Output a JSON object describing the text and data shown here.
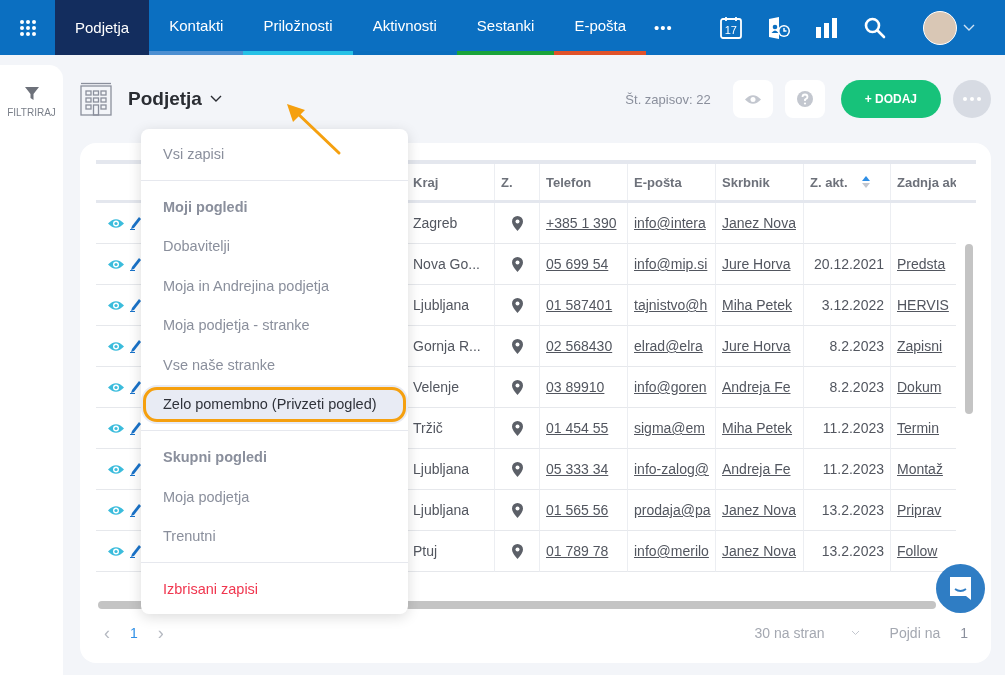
{
  "nav": {
    "tabs": [
      {
        "label": "Podjetja",
        "selected": true,
        "color": "#132d5e"
      },
      {
        "label": "Kontakti",
        "selected": false,
        "color": "#4d8fd1"
      },
      {
        "label": "Priložnosti",
        "selected": false,
        "color": "#26c1e6"
      },
      {
        "label": "Aktivnosti",
        "selected": false,
        "color": "#0a6ebd"
      },
      {
        "label": "Sestanki",
        "selected": false,
        "color": "#19a33a"
      },
      {
        "label": "E-pošta",
        "selected": false,
        "color": "#e0522a"
      }
    ],
    "more": "•••",
    "calendar_day": "17"
  },
  "sidebar": {
    "filter_label": "FILTRIRAJ"
  },
  "header": {
    "title": "Podjetja",
    "record_count": "Št. zapisov: 22",
    "add_button": "+ DODAJ"
  },
  "view_menu": {
    "items": [
      {
        "kind": "option",
        "label": "Vsi zapisi",
        "selected": false,
        "annotated": false
      },
      {
        "kind": "divider"
      },
      {
        "kind": "heading",
        "label": "Moji pogledi"
      },
      {
        "kind": "option",
        "label": "Dobavitelji",
        "selected": false,
        "annotated": false
      },
      {
        "kind": "option",
        "label": "Moja in Andrejina podjetja",
        "selected": false,
        "annotated": false
      },
      {
        "kind": "option",
        "label": "Moja podjetja - stranke",
        "selected": false,
        "annotated": false
      },
      {
        "kind": "option",
        "label": "Vse naše stranke",
        "selected": false,
        "annotated": false
      },
      {
        "kind": "option",
        "label": "Zelo pomembno (Privzeti pogled)",
        "selected": true,
        "annotated": true
      },
      {
        "kind": "divider"
      },
      {
        "kind": "heading",
        "label": "Skupni pogledi"
      },
      {
        "kind": "option",
        "label": "Moja podjetja",
        "selected": false,
        "annotated": false
      },
      {
        "kind": "option",
        "label": "Trenutni",
        "selected": false,
        "annotated": false
      },
      {
        "kind": "divider"
      },
      {
        "kind": "danger",
        "label": "Izbrisani zapisi"
      }
    ]
  },
  "table": {
    "columns": [
      {
        "label": "Kraj",
        "kind": "text",
        "sorted": false
      },
      {
        "label": "Z.",
        "kind": "pin",
        "sorted": false
      },
      {
        "label": "Telefon",
        "kind": "link",
        "sorted": false
      },
      {
        "label": "E-pošta",
        "kind": "link",
        "sorted": false
      },
      {
        "label": "Skrbnik",
        "kind": "link",
        "sorted": false
      },
      {
        "label": "Z. akt.",
        "kind": "date",
        "sorted": true
      },
      {
        "label": "Zadnja ak",
        "kind": "link",
        "sorted": false
      }
    ],
    "rows": [
      {
        "cells": [
          "Zagreb",
          "",
          "+385 1 390",
          "info@intera",
          "Janez Nova"
        ]
      },
      {
        "cells": [
          "Nova Go...",
          "",
          "05 699 54",
          "info@mip.si",
          "Jure Horva",
          "20.12.2021",
          "Predsta"
        ]
      },
      {
        "cells": [
          "Ljubljana",
          "",
          "01 587401",
          "tajnistvo@h",
          "Miha Petek",
          "3.12.2022",
          "HERVIS"
        ]
      },
      {
        "cells": [
          "Gornja R...",
          "",
          "02 568430",
          "elrad@elra",
          "Jure Horva",
          "8.2.2023",
          "Zapisni"
        ]
      },
      {
        "cells": [
          "Velenje",
          "",
          "03 89910",
          "info@goren",
          "Andreja Fe",
          "8.2.2023",
          "Dokum"
        ]
      },
      {
        "cells": [
          "Tržič",
          "",
          "01 454 55",
          "sigma@em",
          "Miha Petek",
          "11.2.2023",
          "Termin"
        ]
      },
      {
        "cells": [
          "Ljubljana",
          "",
          "05 333 34",
          "info-zalog@",
          "Andreja Fe",
          "11.2.2023",
          "Montaž"
        ]
      },
      {
        "cells": [
          "Ljubljana",
          "",
          "01 565 56",
          "prodaja@pa",
          "Janez Nova",
          "13.2.2023",
          "Priprav"
        ]
      },
      {
        "cells": [
          "Ptuj",
          "",
          "01 789 78",
          "info@merilo",
          "Janez Nova",
          "13.2.2023",
          "Follow"
        ]
      }
    ]
  },
  "pagination": {
    "prev": "‹",
    "page": "1",
    "next": "›",
    "per_page": "30 na stran",
    "goto_label": "Pojdi na",
    "goto_value": "1"
  }
}
